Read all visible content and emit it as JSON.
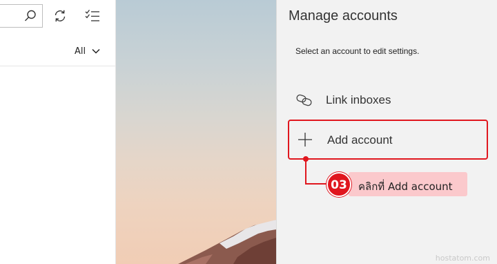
{
  "mail_list": {
    "search": {
      "value": "",
      "placeholder": ""
    },
    "icons": {
      "search": "search-icon",
      "sync": "sync-icon",
      "select": "select-mode-icon"
    },
    "filter": {
      "label": "All"
    }
  },
  "background": {
    "description_icon": "mountain-photo"
  },
  "flyout": {
    "title": "Manage accounts",
    "subtitle": "Select an account to edit settings.",
    "items": [
      {
        "icon": "link-icon",
        "label": "Link inboxes"
      },
      {
        "icon": "plus-icon",
        "label": "Add account"
      }
    ]
  },
  "annotation": {
    "step": "03",
    "text": "คลิกที่ Add account",
    "color": "#e0161e"
  },
  "watermark": "hostatom.com"
}
